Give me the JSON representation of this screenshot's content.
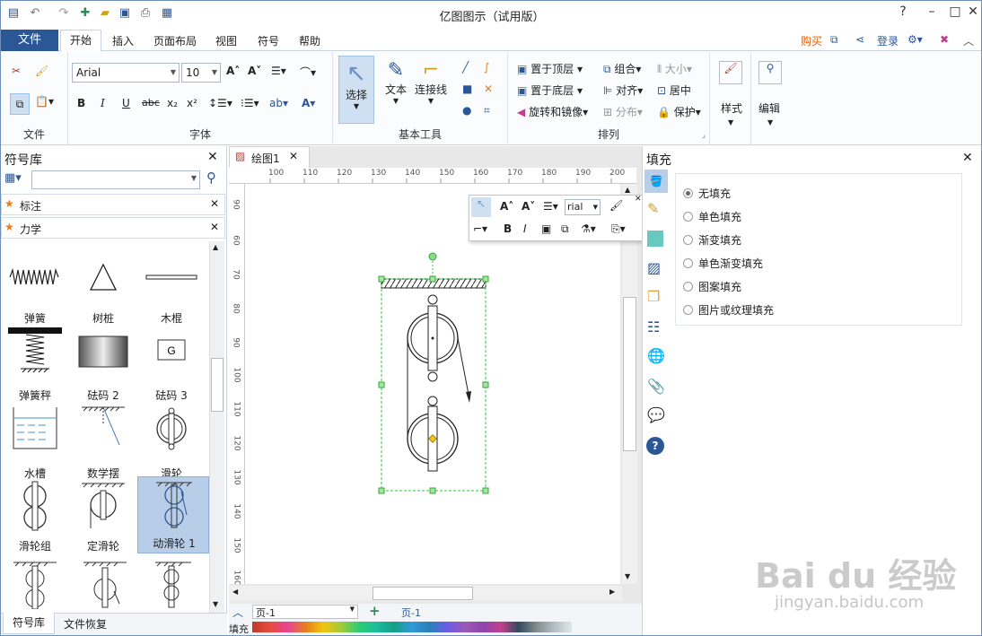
{
  "window": {
    "title": "亿图图示（试用版）"
  },
  "menu": {
    "file": "文件",
    "tabs": [
      "开始",
      "插入",
      "页面布局",
      "视图",
      "符号",
      "帮助"
    ],
    "buy": "购买",
    "login": "登录"
  },
  "ribbon": {
    "groups": {
      "file": "文件",
      "font": "字体",
      "basic": "基本工具",
      "arrange": "排列"
    },
    "font_name": "Arial",
    "font_size": "10",
    "basic": {
      "select": "选择",
      "text": "文本",
      "connector": "连接线"
    },
    "arrange": {
      "front": "置于顶层",
      "back": "置于底层",
      "rotate": "旋转和镜像",
      "group": "组合",
      "align": "对齐",
      "distribute": "分布",
      "size": "大小",
      "center": "居中",
      "protect": "保护"
    },
    "style": "样式",
    "edit": "编辑"
  },
  "library": {
    "title": "符号库",
    "search_placeholder": "",
    "sections": [
      "标注",
      "力学"
    ],
    "items": [
      "弹簧",
      "树桩",
      "木棍",
      "弹簧秤",
      "砝码 2",
      "砝码 3",
      "水槽",
      "数学摆",
      "滑轮",
      "滑轮组",
      "定滑轮",
      "动滑轮 1"
    ],
    "g_label": "G",
    "bottom_tabs": [
      "符号库",
      "文件恢复"
    ]
  },
  "document": {
    "tab": "绘图1",
    "ruler_h": [
      "100",
      "110",
      "120",
      "130",
      "140",
      "150",
      "160",
      "170",
      "180",
      "190",
      "200"
    ],
    "ruler_v": [
      "90",
      "60",
      "70",
      "80",
      "90",
      "100",
      "110",
      "120",
      "130",
      "140",
      "150",
      "160"
    ],
    "floating_font": "rial"
  },
  "pages": {
    "current": "页-1",
    "tab": "页-1",
    "fill_label": "填充"
  },
  "fill_panel": {
    "title": "填充",
    "options": [
      "无填充",
      "单色填充",
      "渐变填充",
      "单色渐变填充",
      "图案填充",
      "图片或纹理填充"
    ],
    "selected": 0
  },
  "watermark": {
    "brand": "Bai du 经验",
    "url": "jingyan.baidu.com"
  },
  "colors": {
    "accent": "#2b5797",
    "selection": "#2ecc40",
    "palette": [
      "#c0392b",
      "#e74c3c",
      "#e67e22",
      "#f1c40f",
      "#2ecc71",
      "#1abc9c",
      "#3498db",
      "#2980b9",
      "#9b59b6",
      "#8e44ad",
      "#34495e",
      "#95a5a6"
    ]
  }
}
